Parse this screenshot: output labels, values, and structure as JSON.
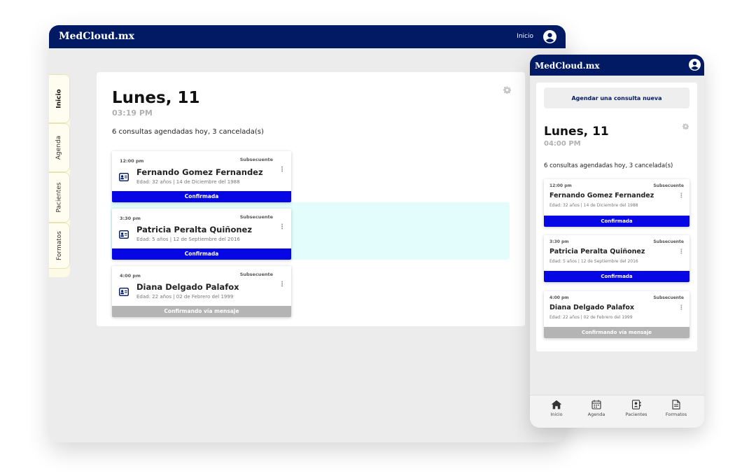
{
  "brand": "MedCloud.mx",
  "desktop": {
    "header_link": "Inicio",
    "side_tabs": [
      "Inicio",
      "Agenda",
      "Pacientes",
      "Formatos"
    ]
  },
  "schedule": {
    "day": "Lunes, 11",
    "desktop_time": "03:19 PM",
    "mobile_time": "04:00 PM",
    "summary": "6 consultas agendadas hoy, 3 cancelada(s)",
    "appointments": [
      {
        "time": "12:00 pm",
        "type": "Subsecuente",
        "name": "Fernando Gomez Fernandez",
        "details": "Edad: 32 años | 14 de Diciembre del 1988",
        "status": "Confirmada",
        "status_color": "#0707e6"
      },
      {
        "time": "3:30 pm",
        "type": "Subsecuente",
        "name": "Patricia Peralta Quiñonez",
        "details": "Edad: 5 años | 12 de Septiembre del 2016",
        "status": "Confirmada",
        "status_color": "#0707e6"
      },
      {
        "time": "4:00 pm",
        "type": "Subsecuente",
        "name": "Diana Delgado Palafox",
        "details": "Edad: 22 años | 02 de Febrero del 1999",
        "status": "Confirmando vía mensaje",
        "status_color": "#b4b4b4"
      }
    ]
  },
  "mobile": {
    "new_appointment_button": "Agendar una consulta nueva",
    "nav": [
      "Inicio",
      "Agenda",
      "Pacientes",
      "Formatos"
    ]
  },
  "colors": {
    "navy": "#011a63",
    "confirmed": "#0707e6",
    "pending": "#b4b4b4",
    "highlight": "#e3fcfc",
    "side_tab": "#fffdf0"
  },
  "icons": [
    "user-circle-icon",
    "gear-icon",
    "patient-card-icon",
    "kebab-menu-icon",
    "add-circle-icon",
    "home-icon",
    "calendar-icon",
    "patients-icon",
    "document-icon"
  ]
}
